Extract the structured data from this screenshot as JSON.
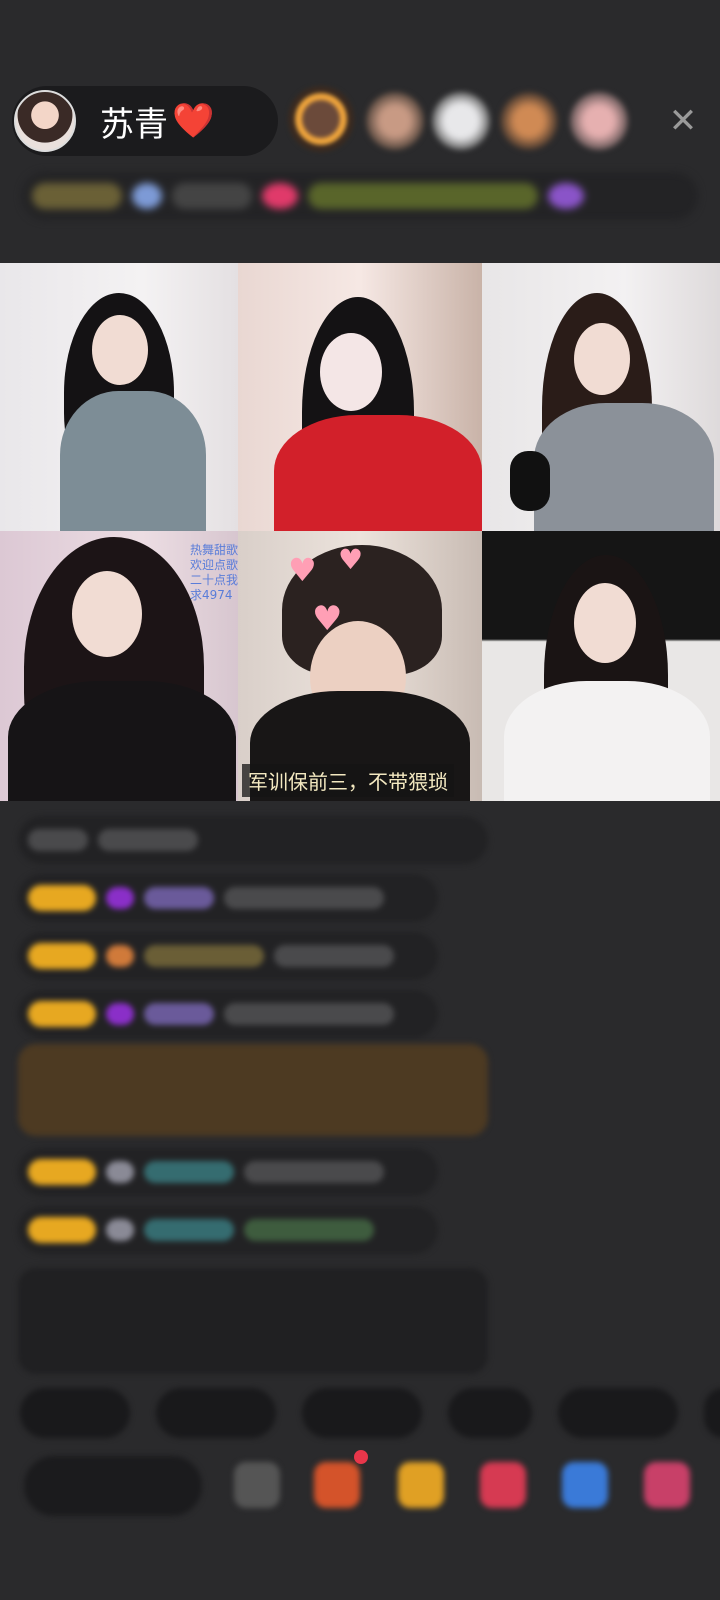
{
  "header": {
    "host_name": "苏青",
    "host_badge": "❤️",
    "close_icon": "✕"
  },
  "grid": {
    "tiles": [
      {
        "id": "seat-1"
      },
      {
        "id": "seat-2"
      },
      {
        "id": "seat-3"
      },
      {
        "id": "seat-4",
        "overlay_lines": [
          "热舞甜歌",
          "欢迎点歌",
          "二十点我",
          "求4974"
        ]
      },
      {
        "id": "seat-5",
        "subtitle": "军训保前三，不带猥琐"
      },
      {
        "id": "seat-6"
      }
    ]
  },
  "colors": {
    "background": "#2a2a2c",
    "badge_gold": "#e7a821",
    "subtitle_text": "#f3e8c0",
    "notice_green": "#7fb24a",
    "name_purple": "#8a5cd6",
    "name_teal": "#3fa0a8"
  }
}
